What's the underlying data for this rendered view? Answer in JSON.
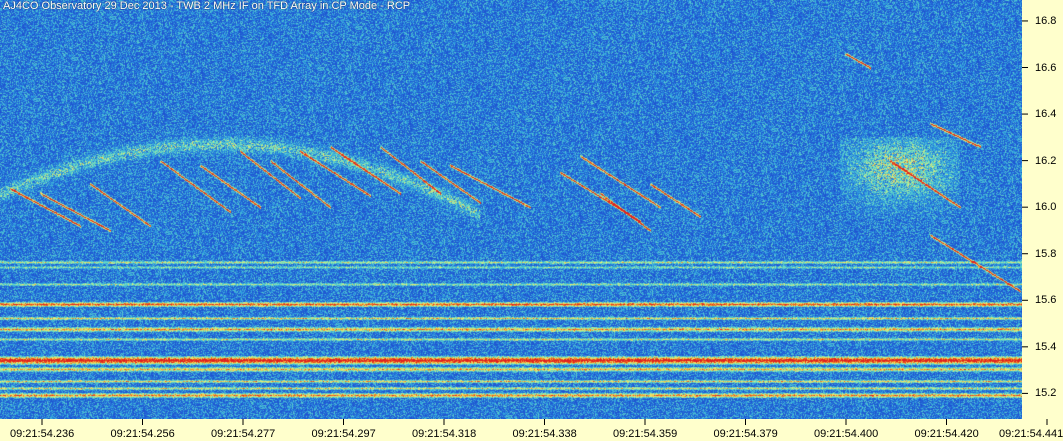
{
  "chart_data": {
    "type": "heatmap",
    "title": "AJ4CO Observatory 29 Dec 2013 - TWB 2 MHz IF on TFD Array in CP Mode - RCP",
    "xlabel": "",
    "ylabel": "",
    "x_tick_labels": [
      "09:21:54.236",
      "09:21:54.256",
      "09:21:54.277",
      "09:21:54.297",
      "09:21:54.318",
      "09:21:54.338",
      "09:21:54.359",
      "09:21:54.379",
      "09:21:54.400",
      "09:21:54.420",
      "09:21:54.441"
    ],
    "y_tick_labels": [
      "16.8",
      "16.6",
      "16.4",
      "16.2",
      "16.0",
      "15.8",
      "15.6",
      "15.4",
      "15.2"
    ],
    "y_ticks": [
      16.8,
      16.6,
      16.4,
      16.2,
      16.0,
      15.8,
      15.6,
      15.4,
      15.2
    ],
    "ylim": [
      15.09,
      16.89
    ],
    "colormap": [
      "#0a2390",
      "#1d4bd0",
      "#2fa0e0",
      "#6fe0c0",
      "#f0f070",
      "#f08020",
      "#e02020"
    ],
    "background_color": "#0b2c9c",
    "axis_panel_color": "#ffffcc",
    "grid": false
  }
}
